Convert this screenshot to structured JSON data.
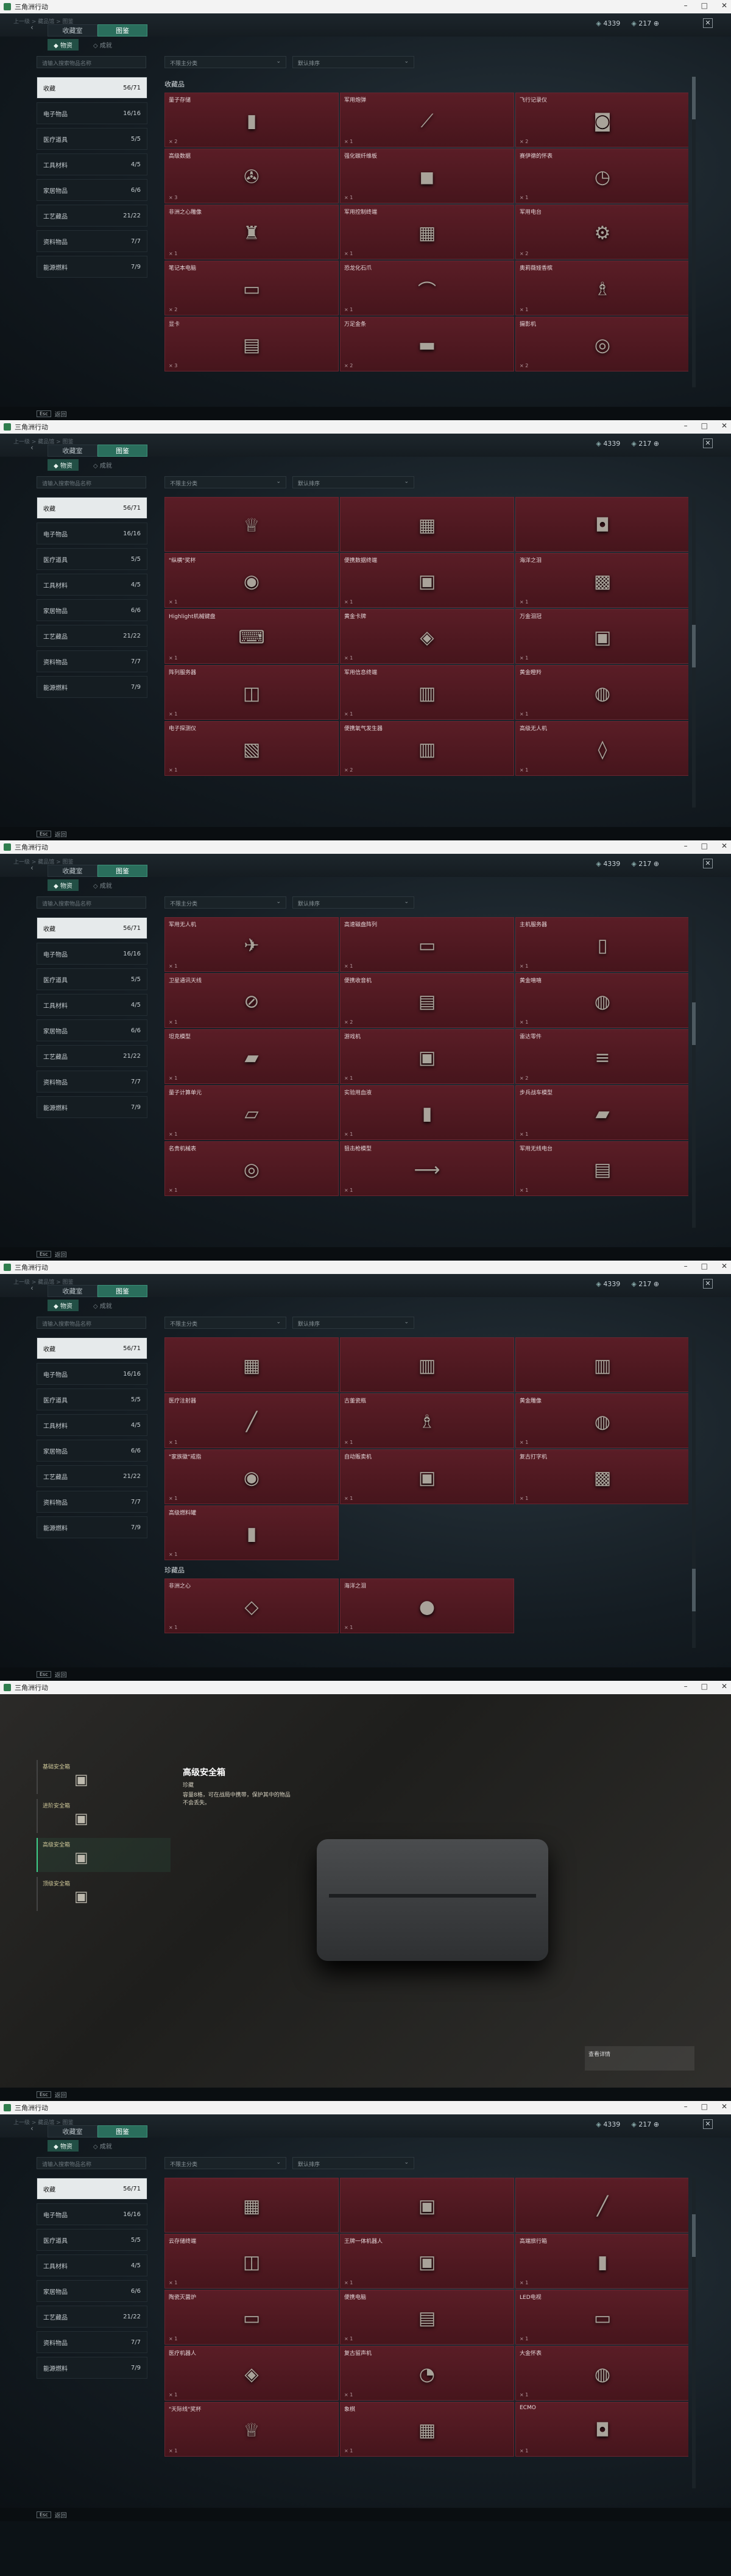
{
  "window": {
    "title": "三角洲行动",
    "controls": [
      "–",
      "□",
      "✕"
    ]
  },
  "top": {
    "crumb": "上一级 > 藏品馆 > 图鉴",
    "res1": "4339",
    "res2": "217 ⊕",
    "close": "✕",
    "back": "‹"
  },
  "tabs": [
    {
      "label": "收藏室"
    },
    {
      "label": "图鉴"
    }
  ],
  "subtabs": [
    {
      "label": "◆ 物资"
    },
    {
      "label": "◇ 成就"
    }
  ],
  "search": {
    "placeholder": "请输入搜索物品名称"
  },
  "filter1": {
    "value": "不限主分类"
  },
  "filter2": {
    "value": "默认排序"
  },
  "sidebar": [
    {
      "label": "收藏",
      "count": "56/71"
    },
    {
      "label": "电子物品",
      "count": "16/16"
    },
    {
      "label": "医疗道具",
      "count": "5/5"
    },
    {
      "label": "工具材料",
      "count": "4/5"
    },
    {
      "label": "家居物品",
      "count": "6/6"
    },
    {
      "label": "工艺藏品",
      "count": "21/22"
    },
    {
      "label": "资料物品",
      "count": "7/7"
    },
    {
      "label": "能源燃料",
      "count": "7/9"
    }
  ],
  "bottom": {
    "key": "Esc",
    "label": "返回"
  },
  "screens": [
    {
      "section": "收藏品",
      "items": [
        {
          "name": "量子存储",
          "qty": "× 2",
          "icon": "▮"
        },
        {
          "name": "军用炮弹",
          "qty": "× 1",
          "icon": "⟋"
        },
        {
          "name": "飞行记录仪",
          "qty": "× 2",
          "icon": "◙"
        },
        {
          "name": "高级数据",
          "qty": "× 3",
          "icon": "✇"
        },
        {
          "name": "强化碳纤维板",
          "qty": "× 1",
          "icon": "◼"
        },
        {
          "name": "赛伊德的怀表",
          "qty": "× 1",
          "icon": "◷"
        },
        {
          "name": "非洲之心雕像",
          "qty": "× 1",
          "icon": "♜"
        },
        {
          "name": "军用控制终端",
          "qty": "× 1",
          "icon": "▦"
        },
        {
          "name": "军用电台",
          "qty": "× 2",
          "icon": "⚙"
        },
        {
          "name": "笔记本电脑",
          "qty": "× 2",
          "icon": "▭"
        },
        {
          "name": "恐龙化石爪",
          "qty": "× 1",
          "icon": "⌒"
        },
        {
          "name": "奥莉薇娅香槟",
          "qty": "× 1",
          "icon": "♗"
        },
        {
          "name": "显卡",
          "qty": "× 3",
          "icon": "▤"
        },
        {
          "name": "万足金条",
          "qty": "× 2",
          "icon": "▬"
        },
        {
          "name": "摄影机",
          "qty": "× 2",
          "icon": "◎"
        }
      ]
    },
    {
      "section": "",
      "items": [
        {
          "name": "",
          "qty": "",
          "icon": "♕"
        },
        {
          "name": "",
          "qty": "",
          "icon": "▦"
        },
        {
          "name": "",
          "qty": "",
          "icon": "◘"
        },
        {
          "name": "\"纵横\"奖杯",
          "qty": "× 1",
          "icon": "◉"
        },
        {
          "name": "便携数据终端",
          "qty": "× 1",
          "icon": "▣"
        },
        {
          "name": "海洋之泪",
          "qty": "× 1",
          "icon": "▩"
        },
        {
          "name": "Highlight机械键盘",
          "qty": "× 1",
          "icon": "⌨"
        },
        {
          "name": "黄金卡牌",
          "qty": "× 1",
          "icon": "◈"
        },
        {
          "name": "万金泪冠",
          "qty": "× 1",
          "icon": "▣"
        },
        {
          "name": "阵列服务器",
          "qty": "× 1",
          "icon": "◫"
        },
        {
          "name": "军用信息终端",
          "qty": "× 1",
          "icon": "▥"
        },
        {
          "name": "黄金瞪羚",
          "qty": "× 1",
          "icon": "◍"
        },
        {
          "name": "电子探测仪",
          "qty": "× 1",
          "icon": "▧"
        },
        {
          "name": "便携氧气发生器",
          "qty": "× 2",
          "icon": "▥"
        },
        {
          "name": "高级无人机",
          "qty": "× 1",
          "icon": "◊"
        }
      ]
    },
    {
      "section": "",
      "items": [
        {
          "name": "军用无人机",
          "qty": "× 1",
          "icon": "✈"
        },
        {
          "name": "高速磁盘阵列",
          "qty": "× 1",
          "icon": "▭"
        },
        {
          "name": "主机服务器",
          "qty": "× 1",
          "icon": "▯"
        },
        {
          "name": "卫星通讯天线",
          "qty": "× 1",
          "icon": "⊘"
        },
        {
          "name": "便携收音机",
          "qty": "× 2",
          "icon": "▤"
        },
        {
          "name": "黄金嘻嘻",
          "qty": "× 1",
          "icon": "◍"
        },
        {
          "name": "坦克模型",
          "qty": "× 1",
          "icon": "▰"
        },
        {
          "name": "游戏机",
          "qty": "× 1",
          "icon": "▣"
        },
        {
          "name": "雷达零件",
          "qty": "× 2",
          "icon": "≡"
        },
        {
          "name": "量子计算单元",
          "qty": "× 1",
          "icon": "▱"
        },
        {
          "name": "实验用血液",
          "qty": "× 1",
          "icon": "▮"
        },
        {
          "name": "步兵战车模型",
          "qty": "× 1",
          "icon": "▰"
        },
        {
          "name": "名贵机械表",
          "qty": "× 1",
          "icon": "◎"
        },
        {
          "name": "狙击枪模型",
          "qty": "× 1",
          "icon": "⟶"
        },
        {
          "name": "军用无线电台",
          "qty": "× 1",
          "icon": "▤"
        }
      ]
    },
    {
      "section": "珍藏品",
      "items": [
        {
          "name": "",
          "qty": "",
          "icon": "▦"
        },
        {
          "name": "",
          "qty": "",
          "icon": "▥"
        },
        {
          "name": "",
          "qty": "",
          "icon": "▥"
        },
        {
          "name": "医疗注射器",
          "qty": "× 1",
          "icon": "╱"
        },
        {
          "name": "古董瓷瓶",
          "qty": "× 1",
          "icon": "♗"
        },
        {
          "name": "黄金雕像",
          "qty": "× 1",
          "icon": "◍"
        },
        {
          "name": "\"家族徽\"戒指",
          "qty": "× 1",
          "icon": "◉"
        },
        {
          "name": "自动贩卖机",
          "qty": "× 1",
          "icon": "▣"
        },
        {
          "name": "复古打字机",
          "qty": "× 1",
          "icon": "▩"
        },
        {
          "name": "高级燃料罐",
          "qty": "× 1",
          "icon": "▮"
        },
        {
          "name": "非洲之心",
          "qty": "× 1",
          "icon": "◇"
        },
        {
          "name": "海洋之泪",
          "qty": "× 1",
          "icon": "●"
        }
      ]
    },
    {
      "section": "",
      "items": [
        {
          "name": "",
          "qty": "",
          "icon": "▦"
        },
        {
          "name": "",
          "qty": "",
          "icon": "▣"
        },
        {
          "name": "",
          "qty": "",
          "icon": "╱"
        },
        {
          "name": "云存储终端",
          "qty": "× 1",
          "icon": "◫"
        },
        {
          "name": "王牌一体机器人",
          "qty": "× 1",
          "icon": "▣"
        },
        {
          "name": "高端旅行箱",
          "qty": "× 1",
          "icon": "▮"
        },
        {
          "name": "陶瓷灭菌炉",
          "qty": "× 1",
          "icon": "▭"
        },
        {
          "name": "便携电脑",
          "qty": "× 1",
          "icon": "▤"
        },
        {
          "name": "LED电视",
          "qty": "× 1",
          "icon": "▭"
        },
        {
          "name": "医疗机器人",
          "qty": "× 1",
          "icon": "◈"
        },
        {
          "name": "复古留声机",
          "qty": "× 1",
          "icon": "◔"
        },
        {
          "name": "大金怀表",
          "qty": "× 1",
          "icon": "◍"
        },
        {
          "name": "\"天际线\"奖杯",
          "qty": "× 1",
          "icon": "♕"
        },
        {
          "name": "象棋",
          "qty": "× 1",
          "icon": "▦"
        },
        {
          "name": "ECMO",
          "qty": "× 1",
          "icon": "◘"
        }
      ]
    }
  ],
  "showcase": {
    "title": "高级安全箱",
    "meta": "珍藏   ",
    "desc": "容量8格，可在战局中携带，保护其中的物品不会丢失。",
    "hint": "查看详情",
    "list": [
      {
        "name": "基础安全箱"
      },
      {
        "name": "进阶安全箱"
      },
      {
        "name": "高级安全箱"
      },
      {
        "name": "顶级安全箱"
      }
    ]
  }
}
